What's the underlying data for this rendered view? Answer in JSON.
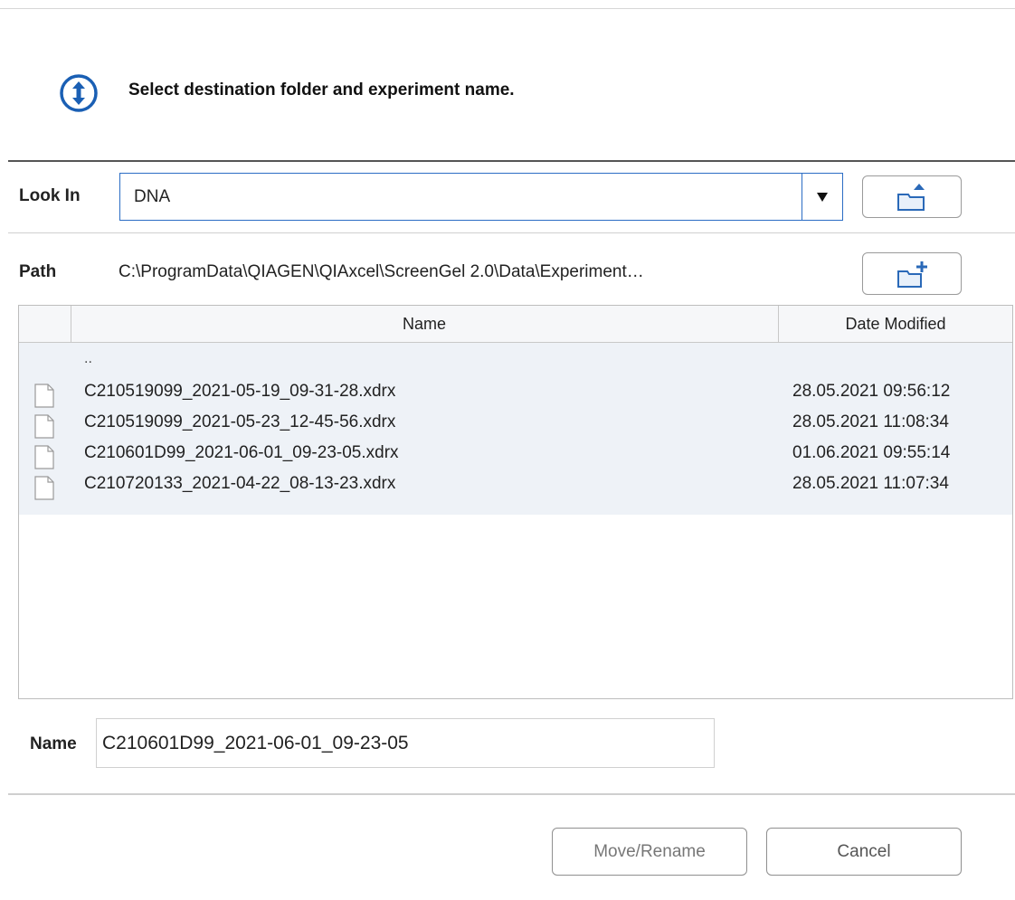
{
  "header": {
    "instruction": "Select destination folder and experiment name.",
    "icon": "move-arrows-icon",
    "accent_color": "#1a5fb4"
  },
  "look_in": {
    "label": "Look In",
    "value": "DNA",
    "dropdown_icon": "triangle-down-icon",
    "up_folder_icon": "folder-up-icon"
  },
  "path": {
    "label": "Path",
    "value": "C:\\ProgramData\\QIAGEN\\QIAxcel\\ScreenGel 2.0\\Data\\Experiment…",
    "new_folder_icon": "new-folder-icon"
  },
  "table": {
    "columns": [
      "",
      "Name",
      "Date Modified"
    ],
    "parent_entry": "..",
    "rows": [
      {
        "name": "C210519099_2021-05-19_09-31-28.xdrx",
        "date": "28.05.2021 09:56:12"
      },
      {
        "name": "C210519099_2021-05-23_12-45-56.xdrx",
        "date": "28.05.2021 11:08:34"
      },
      {
        "name": "C210601D99_2021-06-01_09-23-05.xdrx",
        "date": "01.06.2021 09:55:14"
      },
      {
        "name": "C210720133_2021-04-22_08-13-23.xdrx",
        "date": "28.05.2021 11:07:34"
      }
    ]
  },
  "name_field": {
    "label": "Name",
    "value": "C210601D99_2021-06-01_09-23-05"
  },
  "buttons": {
    "move_rename": "Move/Rename",
    "cancel": "Cancel"
  }
}
